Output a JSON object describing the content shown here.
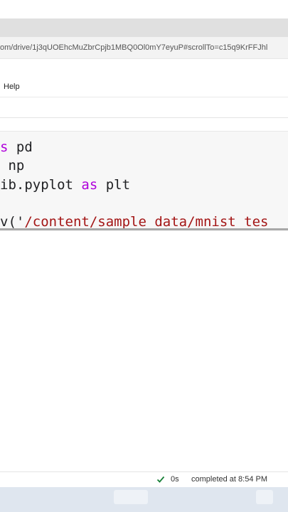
{
  "browser": {
    "url": "om/drive/1j3qUOEhcMuZbrCpjb1MBQ0Ol0mY7eyuP#scrollTo=c15q9KrFFJhl"
  },
  "menu": {
    "help_label": "Help"
  },
  "code": {
    "line1_prefix": "s",
    "line1_rest": " pd",
    "line2": " np",
    "line3_a": "ib.pyplot ",
    "line3_kw": "as",
    "line3_b": " plt",
    "line4_prefix": "v('",
    "line4_string": "/content/sample_data/mnist_tes"
  },
  "status": {
    "check_icon": "checkmark-icon",
    "execution_time": "0s",
    "completed_text": "completed at 8:54 PM",
    "check_color": "#188038"
  }
}
